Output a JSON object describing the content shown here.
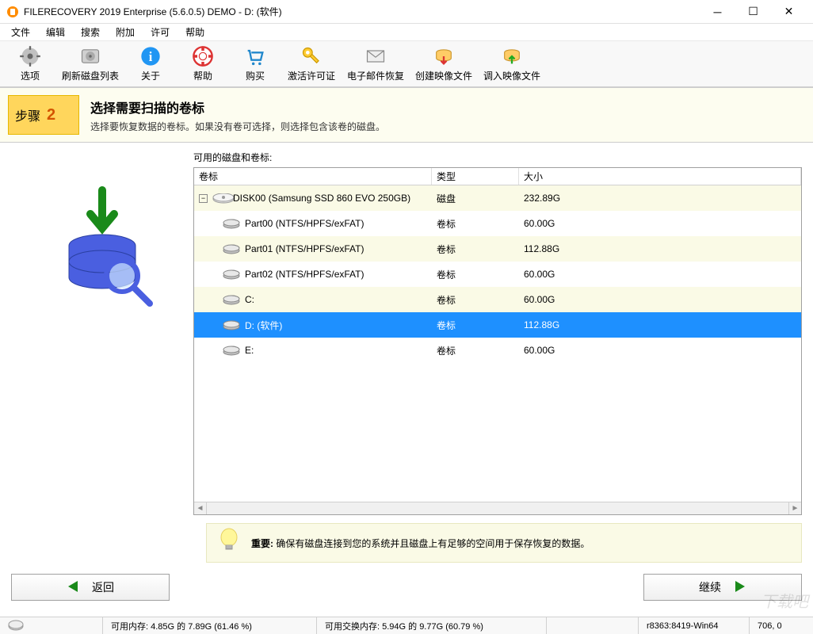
{
  "window": {
    "title": "FILERECOVERY 2019 Enterprise (5.6.0.5) DEMO - D: (软件)"
  },
  "menu": {
    "file": "文件",
    "edit": "编辑",
    "search": "搜索",
    "extras": "附加",
    "license": "许可",
    "help": "帮助"
  },
  "toolbar": {
    "options": "选项",
    "refresh": "刷新磁盘列表",
    "about": "关于",
    "help": "帮助",
    "buy": "购买",
    "activate": "激活许可证",
    "emailRecover": "电子邮件恢复",
    "createImage": "创建映像文件",
    "loadImage": "调入映像文件"
  },
  "step": {
    "label": "步骤",
    "number": "2",
    "title": "选择需要扫描的卷标",
    "subtitle": "选择要恢复数据的卷标。如果没有卷可选择，则选择包含该卷的磁盘。"
  },
  "pane": {
    "label": "可用的磁盘和卷标:",
    "headers": {
      "name": "卷标",
      "type": "类型",
      "size": "大小"
    },
    "rows": [
      {
        "name": "DISK00 (Samsung SSD 860 EVO 250GB)",
        "type": "磁盘",
        "size": "232.89G",
        "level": 0,
        "alt": true,
        "expander": "-",
        "icon": "disk"
      },
      {
        "name": "Part00 (NTFS/HPFS/exFAT)",
        "type": "卷标",
        "size": "60.00G",
        "level": 1,
        "alt": false,
        "icon": "part"
      },
      {
        "name": "Part01 (NTFS/HPFS/exFAT)",
        "type": "卷标",
        "size": "112.88G",
        "level": 1,
        "alt": true,
        "icon": "part"
      },
      {
        "name": "Part02 (NTFS/HPFS/exFAT)",
        "type": "卷标",
        "size": "60.00G",
        "level": 1,
        "alt": false,
        "icon": "part"
      },
      {
        "name": "C:",
        "type": "卷标",
        "size": "60.00G",
        "level": 1,
        "alt": true,
        "icon": "part"
      },
      {
        "name": "D: (软件)",
        "type": "卷标",
        "size": "112.88G",
        "level": 1,
        "alt": false,
        "icon": "part",
        "selected": true
      },
      {
        "name": "E:",
        "type": "卷标",
        "size": "60.00G",
        "level": 1,
        "alt": false,
        "icon": "part"
      }
    ]
  },
  "hint": {
    "prefix": "重要:",
    "text": "确保有磁盘连接到您的系统并且磁盘上有足够的空间用于保存恢复的数据。"
  },
  "nav": {
    "back": "返回",
    "next": "继续"
  },
  "status": {
    "mem": "可用内存: 4.85G 的 7.89G (61.46 %)",
    "swap": "可用交换内存: 5.94G 的 9.77G (60.79 %)",
    "build": "r8363:8419-Win64",
    "coord": "706, 0"
  },
  "watermark": "下载吧"
}
